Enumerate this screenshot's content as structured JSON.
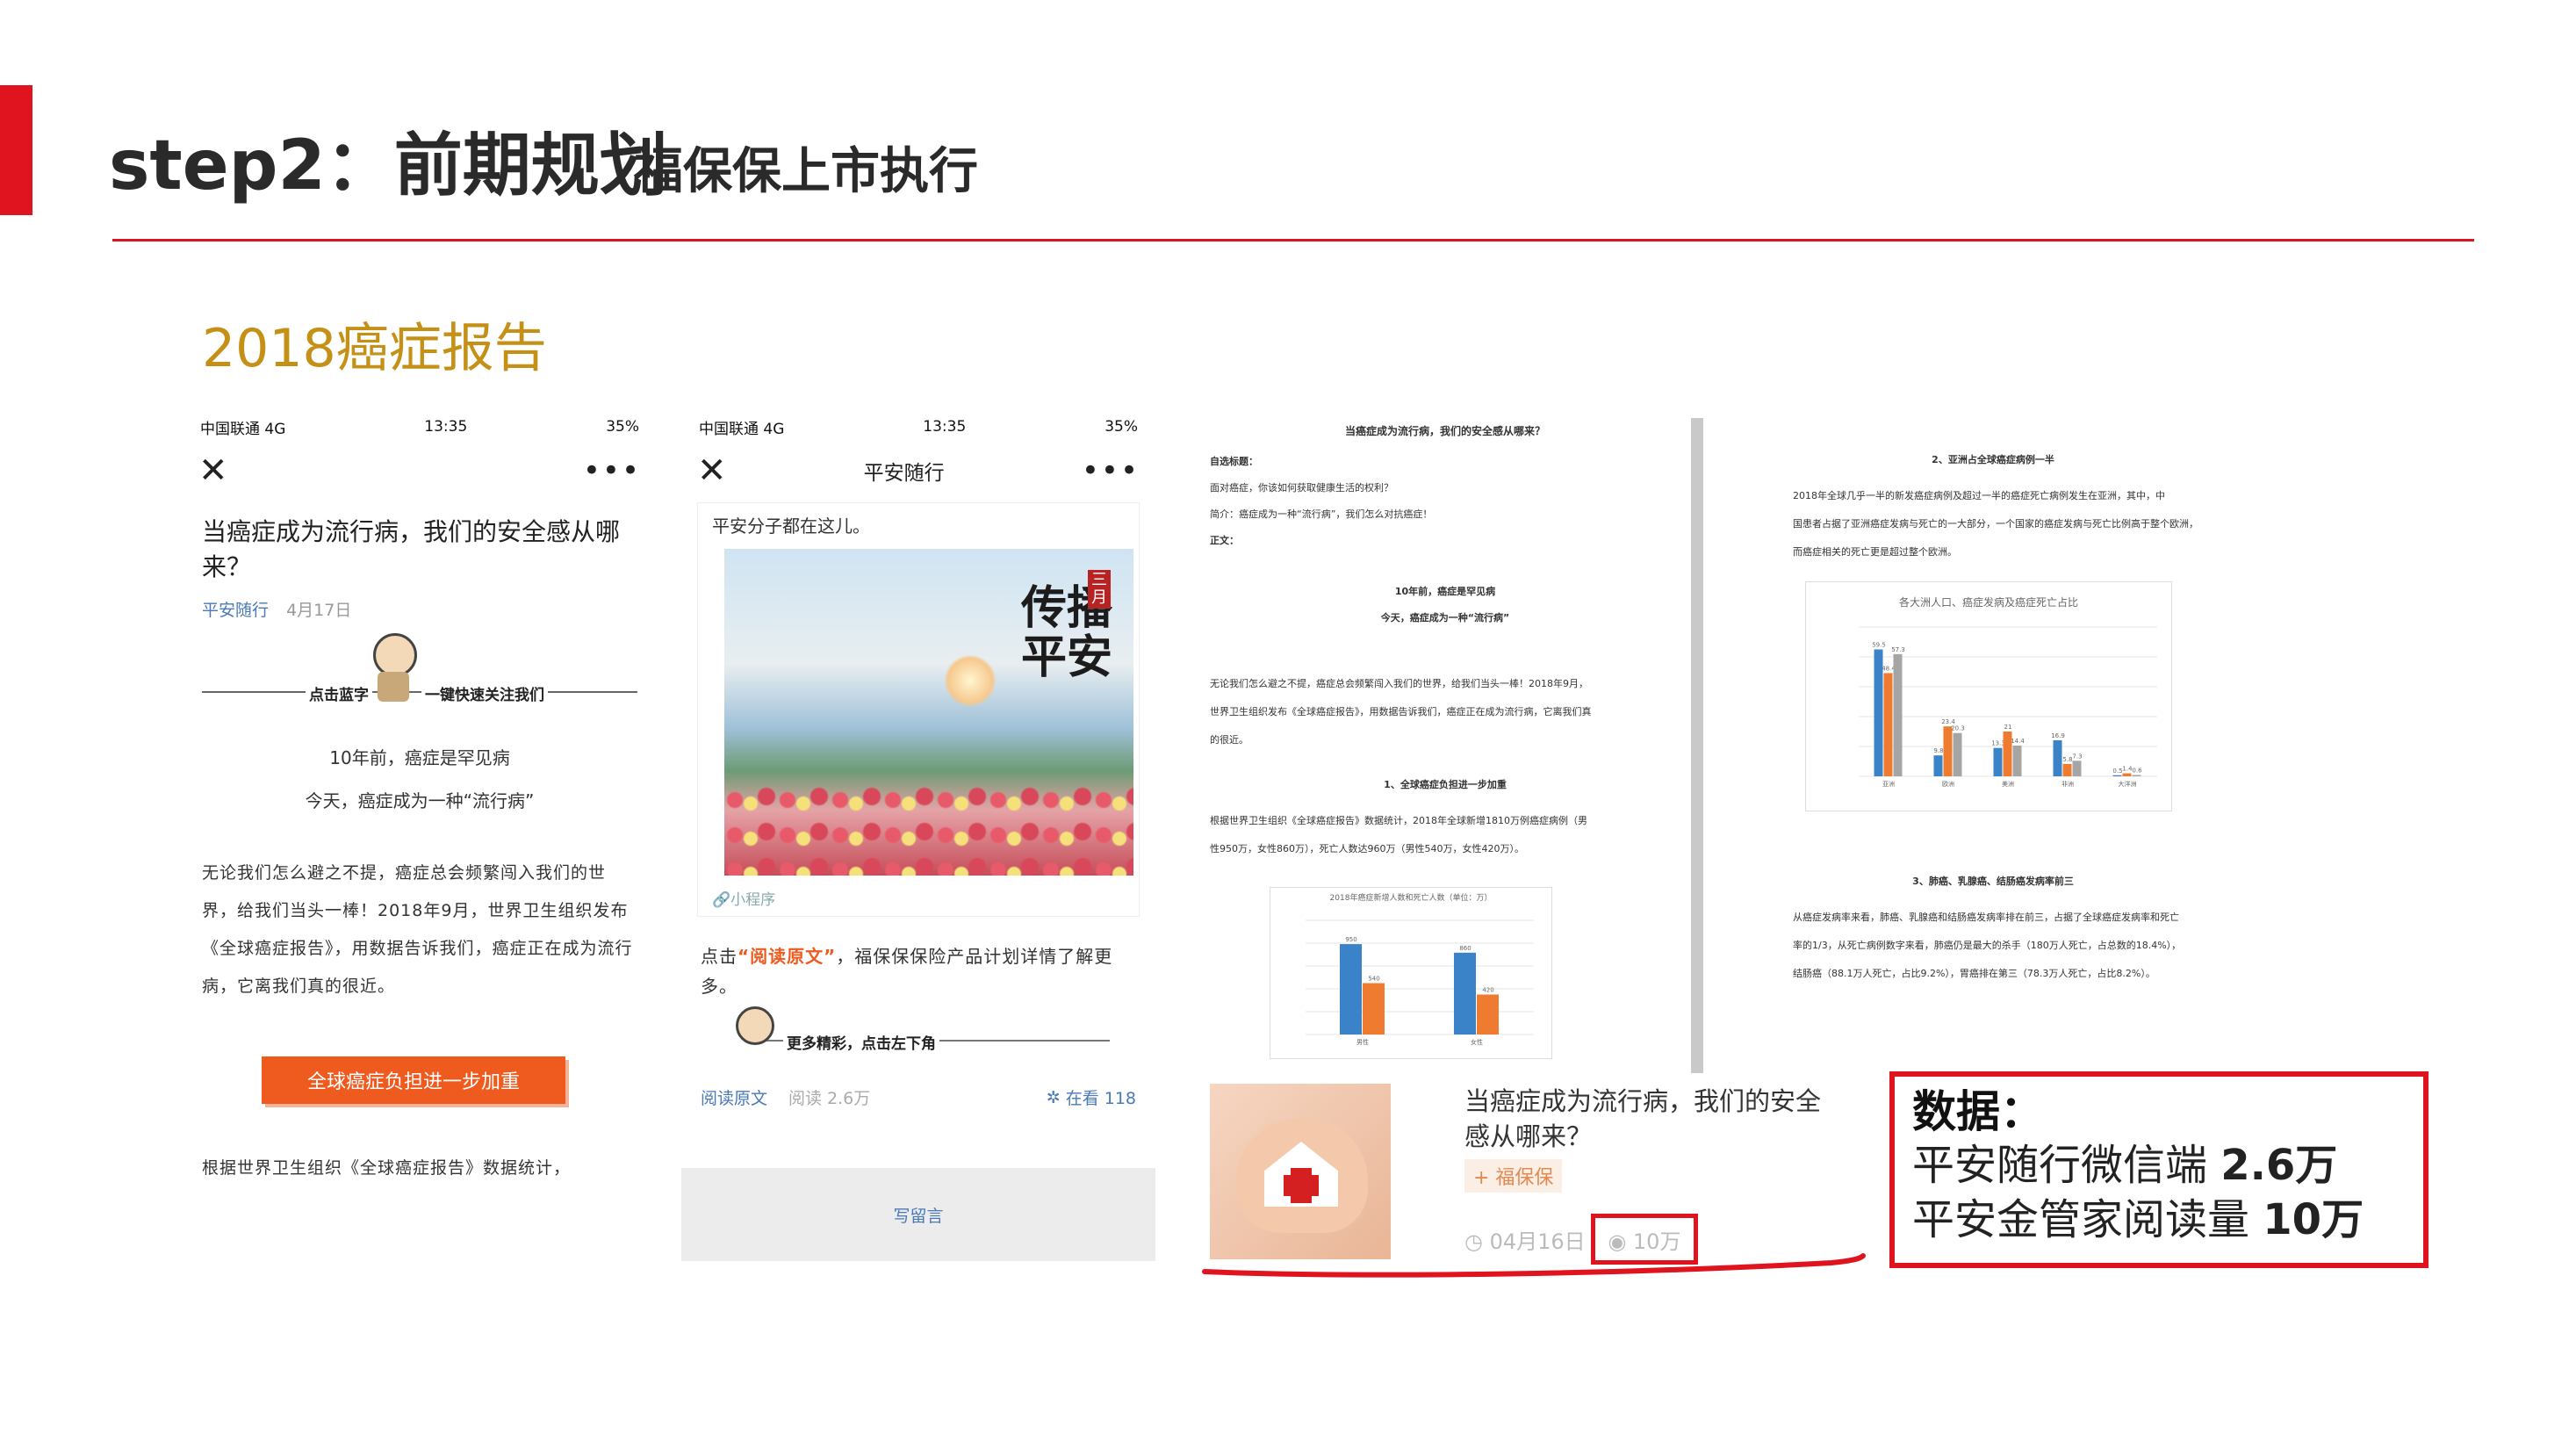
{
  "slide": {
    "title": "step2：前期规划",
    "subtitle": "福保保上市执行",
    "section": "2018癌症报告",
    "colors": {
      "accent": "#e0141e",
      "section": "#c49016",
      "link": "#4a79b8",
      "orange_btn": "#ef5a1f"
    }
  },
  "phone1": {
    "status": {
      "carrier": "中国联通 4G",
      "time": "13:35",
      "battery": "35%"
    },
    "close_icon": "close-icon",
    "more_icon": "more-icon",
    "title": "当癌症成为流行病，我们的安全感从哪来？",
    "account": "平安随行",
    "date": "4月17日",
    "follow": {
      "left": "点击蓝字",
      "right": "一键快速关注我们"
    },
    "line1": "10年前，癌症是罕见病",
    "line2": "今天，癌症成为一种“流行病”",
    "paragraph": "无论我们怎么避之不提，癌症总会频繁闯入我们的世界，给我们当头一棒！2018年9月，世界卫生组织发布《全球癌症报告》，用数据告诉我们，癌症正在成为流行病，它离我们真的很近。",
    "button": "全球癌症负担进一步加重",
    "bottom": "根据世界卫生组织《全球癌症报告》数据统计，"
  },
  "phone2": {
    "status": {
      "carrier": "中国联通 4G",
      "time": "13:35",
      "battery": "35%"
    },
    "nav_title": "平安随行",
    "caption": "平安分子都在这儿。",
    "painting_text": "传播平安",
    "painting_badge": "三月",
    "mini_program": "小程序",
    "cta_prefix": "点击",
    "cta_link": "“阅读原文”",
    "cta_suffix": "，福保保保险产品计划详情了解更多。",
    "more": "更多精彩，点击左下角",
    "read_original": "阅读原文",
    "reads": "阅读 2.6万",
    "watching": "在看 118",
    "comment": "写留言"
  },
  "doc1": {
    "heading": "当癌症成为流行病，我们的安全感从哪来？",
    "labels": [
      "自选标题：",
      "面对癌症，你该如何获取健康生活的权利？",
      "简介：癌症成为一种“流行病”，我们怎么对抗癌症！",
      "正文："
    ],
    "sub1": "10年前，癌症是罕见病",
    "sub2": "今天，癌症成为一种“流行病”",
    "para": [
      "无论我们怎么避之不提，癌症总会频繁闯入我们的世界，给我们当头一棒！2018年9月，",
      "世界卫生组织发布《全球癌症报告》，用数据告诉我们，癌症正在成为流行病，它离我们真",
      "的很近。"
    ],
    "h2": "1、全球癌症负担进一步加重",
    "para2": [
      "根据世界卫生组织《全球癌症报告》数据统计，2018年全球新增1810万例癌症病例（男",
      "性950万，女性860万），死亡人数达960万（男性540万，女性420万）。"
    ],
    "chart_title": "2018年癌症新增人数和死亡人数（单位：万）"
  },
  "doc2": {
    "h1": "2、亚洲占全球癌症病例一半",
    "para": [
      "2018年全球几乎一半的新发癌症病例及超过一半的癌症死亡病例发生在亚洲，其中，中",
      "国患者占据了亚洲癌症发病与死亡的一大部分，一个国家的癌症发病与死亡比例高于整个欧洲，",
      "而癌症相关的死亡更是超过整个欧洲。"
    ],
    "chart_title": "各大洲人口、癌症发病及癌症死亡占比",
    "h2": "3、肺癌、乳腺癌、结肠癌发病率前三",
    "para2": [
      "从癌症发病率来看，肺癌、乳腺癌和结肠癌发病率排在前三，占据了全球癌症发病率和死亡",
      "率的1/3，从死亡病例数字来看，肺癌仍是最大的杀手（180万人死亡，占总数的18.4%），",
      "结肠癌（88.1万人死亡，占比9.2%），胃癌排在第三（78.3万人死亡，占比8.2%）。"
    ]
  },
  "article_card": {
    "title": "当癌症成为流行病，我们的安全感从哪来？",
    "tag": "+ 福保保",
    "date": "04月16日",
    "views": "10万"
  },
  "data_box": {
    "heading": "数据：",
    "line1_text": "平安随行微信端 ",
    "line1_value": "2.6万",
    "line2_text": "平安金管家阅读量 ",
    "line2_value": "10万"
  },
  "chart_data": [
    {
      "type": "bar",
      "title": "2018年癌症新增人数和死亡人数（单位：万）",
      "categories": [
        "男性",
        "女性"
      ],
      "series": [
        {
          "values": [
            950,
            860
          ],
          "color": "#3b83c8"
        },
        {
          "values": [
            540,
            420
          ],
          "color": "#ee7b2f"
        }
      ],
      "ylim": [
        0,
        1200
      ]
    },
    {
      "type": "bar",
      "title": "各大洲人口、癌症发病及癌症死亡占比",
      "categories": [
        "亚洲",
        "欧洲",
        "美洲",
        "非洲",
        "大洋洲"
      ],
      "series": [
        {
          "values": [
            59.5,
            9.8,
            13.3,
            16.9,
            0.5
          ],
          "color": "#3b83c8"
        },
        {
          "values": [
            48.4,
            23.4,
            21.0,
            5.8,
            1.4
          ],
          "color": "#ee7b2f"
        },
        {
          "values": [
            57.3,
            20.3,
            14.4,
            7.3,
            0.6
          ],
          "color": "#a5a5a5"
        }
      ],
      "ylim": [
        0,
        70
      ]
    }
  ]
}
